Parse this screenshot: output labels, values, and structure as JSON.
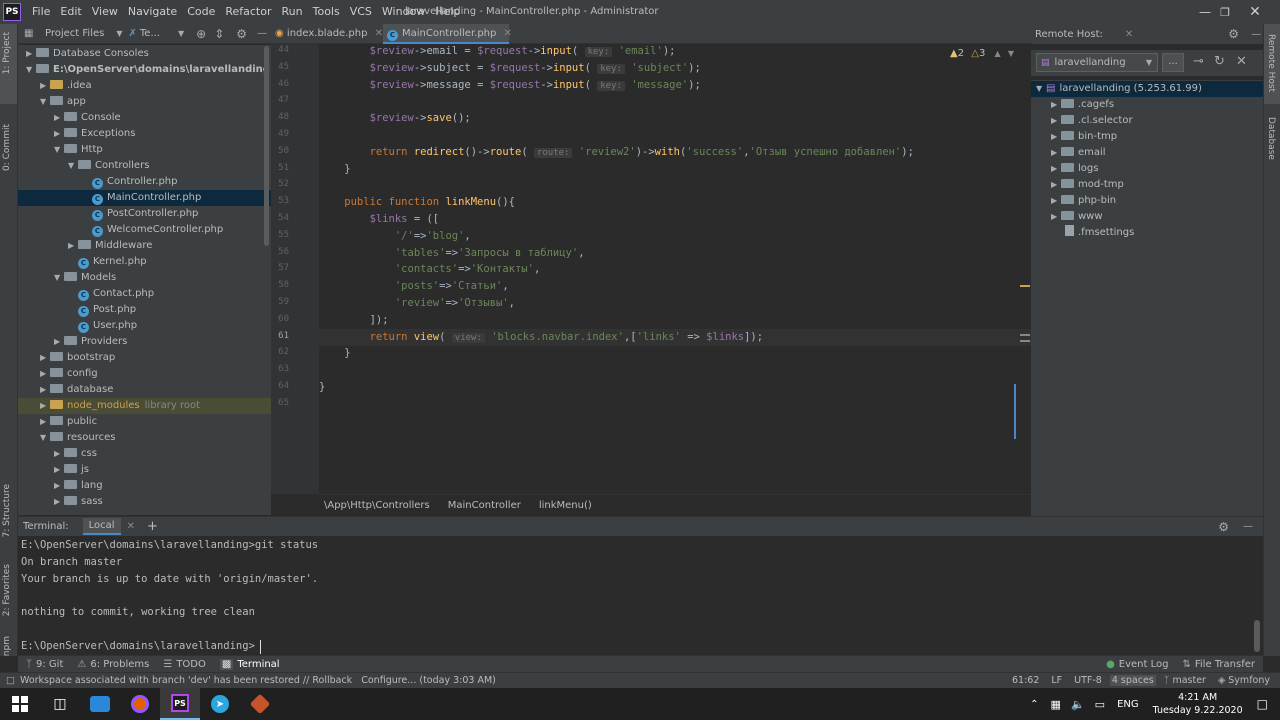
{
  "window": {
    "title": "laravellanding - MainController.php - Administrator",
    "logo": "PS"
  },
  "menu": [
    "File",
    "Edit",
    "View",
    "Navigate",
    "Code",
    "Refactor",
    "Run",
    "Tools",
    "VCS",
    "Window",
    "Help"
  ],
  "left_strip": [
    "1: Project",
    "0: Commit",
    "7: Structure",
    "2: Favorites",
    "npm"
  ],
  "project": {
    "tab_project": "Project Files",
    "tab_te": "Te...",
    "tree": [
      {
        "label": "Database Consoles",
        "depth": 0,
        "arrow": "right",
        "icon": "folder"
      },
      {
        "label": "E:\\OpenServer\\domains\\laravellanding",
        "depth": 0,
        "arrow": "down",
        "icon": "folder",
        "bold": true
      },
      {
        "label": ".idea",
        "depth": 1,
        "arrow": "right",
        "icon": "folder-orange"
      },
      {
        "label": "app",
        "depth": 1,
        "arrow": "down",
        "icon": "folder"
      },
      {
        "label": "Console",
        "depth": 2,
        "arrow": "right",
        "icon": "folder"
      },
      {
        "label": "Exceptions",
        "depth": 2,
        "arrow": "right",
        "icon": "folder"
      },
      {
        "label": "Http",
        "depth": 2,
        "arrow": "down",
        "icon": "folder"
      },
      {
        "label": "Controllers",
        "depth": 3,
        "arrow": "down",
        "icon": "folder"
      },
      {
        "label": "Controller.php",
        "depth": 4,
        "arrow": "",
        "icon": "file"
      },
      {
        "label": "MainController.php",
        "depth": 4,
        "arrow": "",
        "icon": "file",
        "selected": true
      },
      {
        "label": "PostController.php",
        "depth": 4,
        "arrow": "",
        "icon": "file"
      },
      {
        "label": "WelcomeController.php",
        "depth": 4,
        "arrow": "",
        "icon": "file"
      },
      {
        "label": "Middleware",
        "depth": 3,
        "arrow": "right",
        "icon": "folder"
      },
      {
        "label": "Kernel.php",
        "depth": 3,
        "arrow": "",
        "icon": "file"
      },
      {
        "label": "Models",
        "depth": 2,
        "arrow": "down",
        "icon": "folder"
      },
      {
        "label": "Contact.php",
        "depth": 3,
        "arrow": "",
        "icon": "file"
      },
      {
        "label": "Post.php",
        "depth": 3,
        "arrow": "",
        "icon": "file"
      },
      {
        "label": "User.php",
        "depth": 3,
        "arrow": "",
        "icon": "file"
      },
      {
        "label": "Providers",
        "depth": 2,
        "arrow": "right",
        "icon": "folder"
      },
      {
        "label": "bootstrap",
        "depth": 1,
        "arrow": "right",
        "icon": "folder"
      },
      {
        "label": "config",
        "depth": 1,
        "arrow": "right",
        "icon": "folder"
      },
      {
        "label": "database",
        "depth": 1,
        "arrow": "right",
        "icon": "folder"
      },
      {
        "label": "node_modules",
        "depth": 1,
        "arrow": "right",
        "icon": "folder-orange",
        "excluded": true,
        "suffix": "library root"
      },
      {
        "label": "public",
        "depth": 1,
        "arrow": "right",
        "icon": "folder"
      },
      {
        "label": "resources",
        "depth": 1,
        "arrow": "down",
        "icon": "folder"
      },
      {
        "label": "css",
        "depth": 2,
        "arrow": "right",
        "icon": "folder"
      },
      {
        "label": "js",
        "depth": 2,
        "arrow": "right",
        "icon": "folder"
      },
      {
        "label": "lang",
        "depth": 2,
        "arrow": "right",
        "icon": "folder"
      },
      {
        "label": "sass",
        "depth": 2,
        "arrow": "right",
        "icon": "folder"
      }
    ]
  },
  "tabs": [
    {
      "label": "index.blade.php",
      "active": false
    },
    {
      "label": "MainController.php",
      "active": true
    }
  ],
  "warnings": {
    "w1": "2",
    "w2": "3"
  },
  "code": [
    {
      "n": "44",
      "tokens": [
        [
          "v",
          "        $review"
        ],
        [
          "p",
          "->"
        ],
        [
          "p",
          "email"
        ],
        [
          "p",
          " = "
        ],
        [
          "v",
          "$request"
        ],
        [
          "p",
          "->"
        ],
        [
          "f",
          "input"
        ],
        [
          "p",
          "( "
        ],
        [
          "h",
          "key:"
        ],
        [
          "s",
          " 'email'"
        ],
        [
          "p",
          ");"
        ]
      ]
    },
    {
      "n": "45",
      "tokens": [
        [
          "v",
          "        $review"
        ],
        [
          "p",
          "->"
        ],
        [
          "p",
          "subject"
        ],
        [
          "p",
          " = "
        ],
        [
          "v",
          "$request"
        ],
        [
          "p",
          "->"
        ],
        [
          "f",
          "input"
        ],
        [
          "p",
          "( "
        ],
        [
          "h",
          "key:"
        ],
        [
          "s",
          " 'subject'"
        ],
        [
          "p",
          ");"
        ]
      ]
    },
    {
      "n": "46",
      "tokens": [
        [
          "v",
          "        $review"
        ],
        [
          "p",
          "->"
        ],
        [
          "p",
          "message"
        ],
        [
          "p",
          " = "
        ],
        [
          "v",
          "$request"
        ],
        [
          "p",
          "->"
        ],
        [
          "f",
          "input"
        ],
        [
          "p",
          "( "
        ],
        [
          "h",
          "key:"
        ],
        [
          "s",
          " 'message'"
        ],
        [
          "p",
          ");"
        ]
      ]
    },
    {
      "n": "47",
      "tokens": []
    },
    {
      "n": "48",
      "tokens": [
        [
          "v",
          "        $review"
        ],
        [
          "p",
          "->"
        ],
        [
          "f",
          "save"
        ],
        [
          "p",
          "();"
        ]
      ]
    },
    {
      "n": "49",
      "tokens": []
    },
    {
      "n": "50",
      "tokens": [
        [
          "k",
          "        return "
        ],
        [
          "f",
          "redirect"
        ],
        [
          "p",
          "()->"
        ],
        [
          "f",
          "route"
        ],
        [
          "p",
          "( "
        ],
        [
          "h",
          "route:"
        ],
        [
          "s",
          " 'review2'"
        ],
        [
          "p",
          ")->"
        ],
        [
          "f",
          "with"
        ],
        [
          "p",
          "("
        ],
        [
          "s",
          "'success'"
        ],
        [
          "p",
          ","
        ],
        [
          "s",
          "'Отзыв успешно добавлен'"
        ],
        [
          "p",
          ");"
        ]
      ]
    },
    {
      "n": "51",
      "tokens": [
        [
          "p",
          "    }"
        ]
      ]
    },
    {
      "n": "52",
      "tokens": []
    },
    {
      "n": "53",
      "tokens": [
        [
          "k",
          "    public function "
        ],
        [
          "f",
          "linkMenu"
        ],
        [
          "p",
          "(){"
        ]
      ]
    },
    {
      "n": "54",
      "tokens": [
        [
          "v",
          "        $links"
        ],
        [
          "p",
          " = (["
        ]
      ]
    },
    {
      "n": "55",
      "tokens": [
        [
          "s",
          "            '/'"
        ],
        [
          "p",
          "=>"
        ],
        [
          "s",
          "'blog'"
        ],
        [
          "p",
          ","
        ]
      ]
    },
    {
      "n": "56",
      "tokens": [
        [
          "s",
          "            'tables'"
        ],
        [
          "p",
          "=>"
        ],
        [
          "s",
          "'Запросы в таблицу'"
        ],
        [
          "p",
          ","
        ]
      ]
    },
    {
      "n": "57",
      "tokens": [
        [
          "s",
          "            'contacts'"
        ],
        [
          "p",
          "=>"
        ],
        [
          "s",
          "'Контакты'"
        ],
        [
          "p",
          ","
        ]
      ]
    },
    {
      "n": "58",
      "tokens": [
        [
          "s",
          "            'posts'"
        ],
        [
          "p",
          "=>"
        ],
        [
          "s",
          "'Статьи'"
        ],
        [
          "p",
          ","
        ]
      ]
    },
    {
      "n": "59",
      "tokens": [
        [
          "s",
          "            'review'"
        ],
        [
          "p",
          "=>"
        ],
        [
          "s",
          "'Отзывы'"
        ],
        [
          "p",
          ","
        ]
      ]
    },
    {
      "n": "60",
      "tokens": [
        [
          "p",
          "        ]);"
        ]
      ]
    },
    {
      "n": "61",
      "tokens": [
        [
          "k",
          "        return "
        ],
        [
          "f",
          "view"
        ],
        [
          "p",
          "( "
        ],
        [
          "h",
          "view:"
        ],
        [
          "s",
          " 'blocks.navbar.index'"
        ],
        [
          "p",
          ",["
        ],
        [
          "s",
          "'links'"
        ],
        [
          "p",
          " => "
        ],
        [
          "v",
          "$links"
        ],
        [
          "p",
          "]);"
        ]
      ],
      "current": true
    },
    {
      "n": "62",
      "tokens": [
        [
          "p",
          "    }"
        ]
      ]
    },
    {
      "n": "63",
      "tokens": []
    },
    {
      "n": "64",
      "tokens": [
        [
          "p",
          "}"
        ]
      ]
    },
    {
      "n": "65",
      "tokens": []
    }
  ],
  "breadcrumbs": [
    "\\App\\Http\\Controllers",
    "MainController",
    "linkMenu()"
  ],
  "remote": {
    "title": "Remote Host:",
    "server": "laravellanding",
    "dots": "...",
    "root": "laravellanding (5.253.61.99)",
    "items": [
      {
        "label": ".cagefs",
        "type": "folder"
      },
      {
        "label": ".cl.selector",
        "type": "folder"
      },
      {
        "label": "bin-tmp",
        "type": "folder"
      },
      {
        "label": "email",
        "type": "folder"
      },
      {
        "label": "logs",
        "type": "folder"
      },
      {
        "label": "mod-tmp",
        "type": "folder"
      },
      {
        "label": "php-bin",
        "type": "folder"
      },
      {
        "label": "www",
        "type": "folder"
      },
      {
        "label": ".fmsettings",
        "type": "file"
      }
    ]
  },
  "right_strip": [
    "Remote Host",
    "Database"
  ],
  "terminal": {
    "label": "Terminal:",
    "tab": "Local",
    "plus": "+",
    "lines": [
      "E:\\OpenServer\\domains\\laravellanding>git status",
      "On branch master",
      "Your branch is up to date with 'origin/master'.",
      "",
      "nothing to commit, working tree clean",
      "",
      "E:\\OpenServer\\domains\\laravellanding>"
    ]
  },
  "bottom_tools": {
    "git": "9: Git",
    "problems": "6: Problems",
    "todo": "TODO",
    "terminal": "Terminal",
    "event_log": "Event Log",
    "file_transfer": "File Transfer"
  },
  "status": {
    "message": "Workspace associated with branch 'dev' has been restored // Rollback   Configure... (today 3:03 AM)",
    "position": "61:62",
    "line_sep": "LF",
    "encoding": "UTF-8",
    "indent": "4 spaces",
    "branch": "master",
    "framework": "Symfony"
  },
  "taskbar": {
    "lang": "ENG",
    "time": "4:21 AM",
    "date": "Tuesday 9.22.2020"
  },
  "colors": {
    "accent": "#4a88c7",
    "selection": "#0d293e",
    "ps_logo": "#9a5cf0"
  }
}
